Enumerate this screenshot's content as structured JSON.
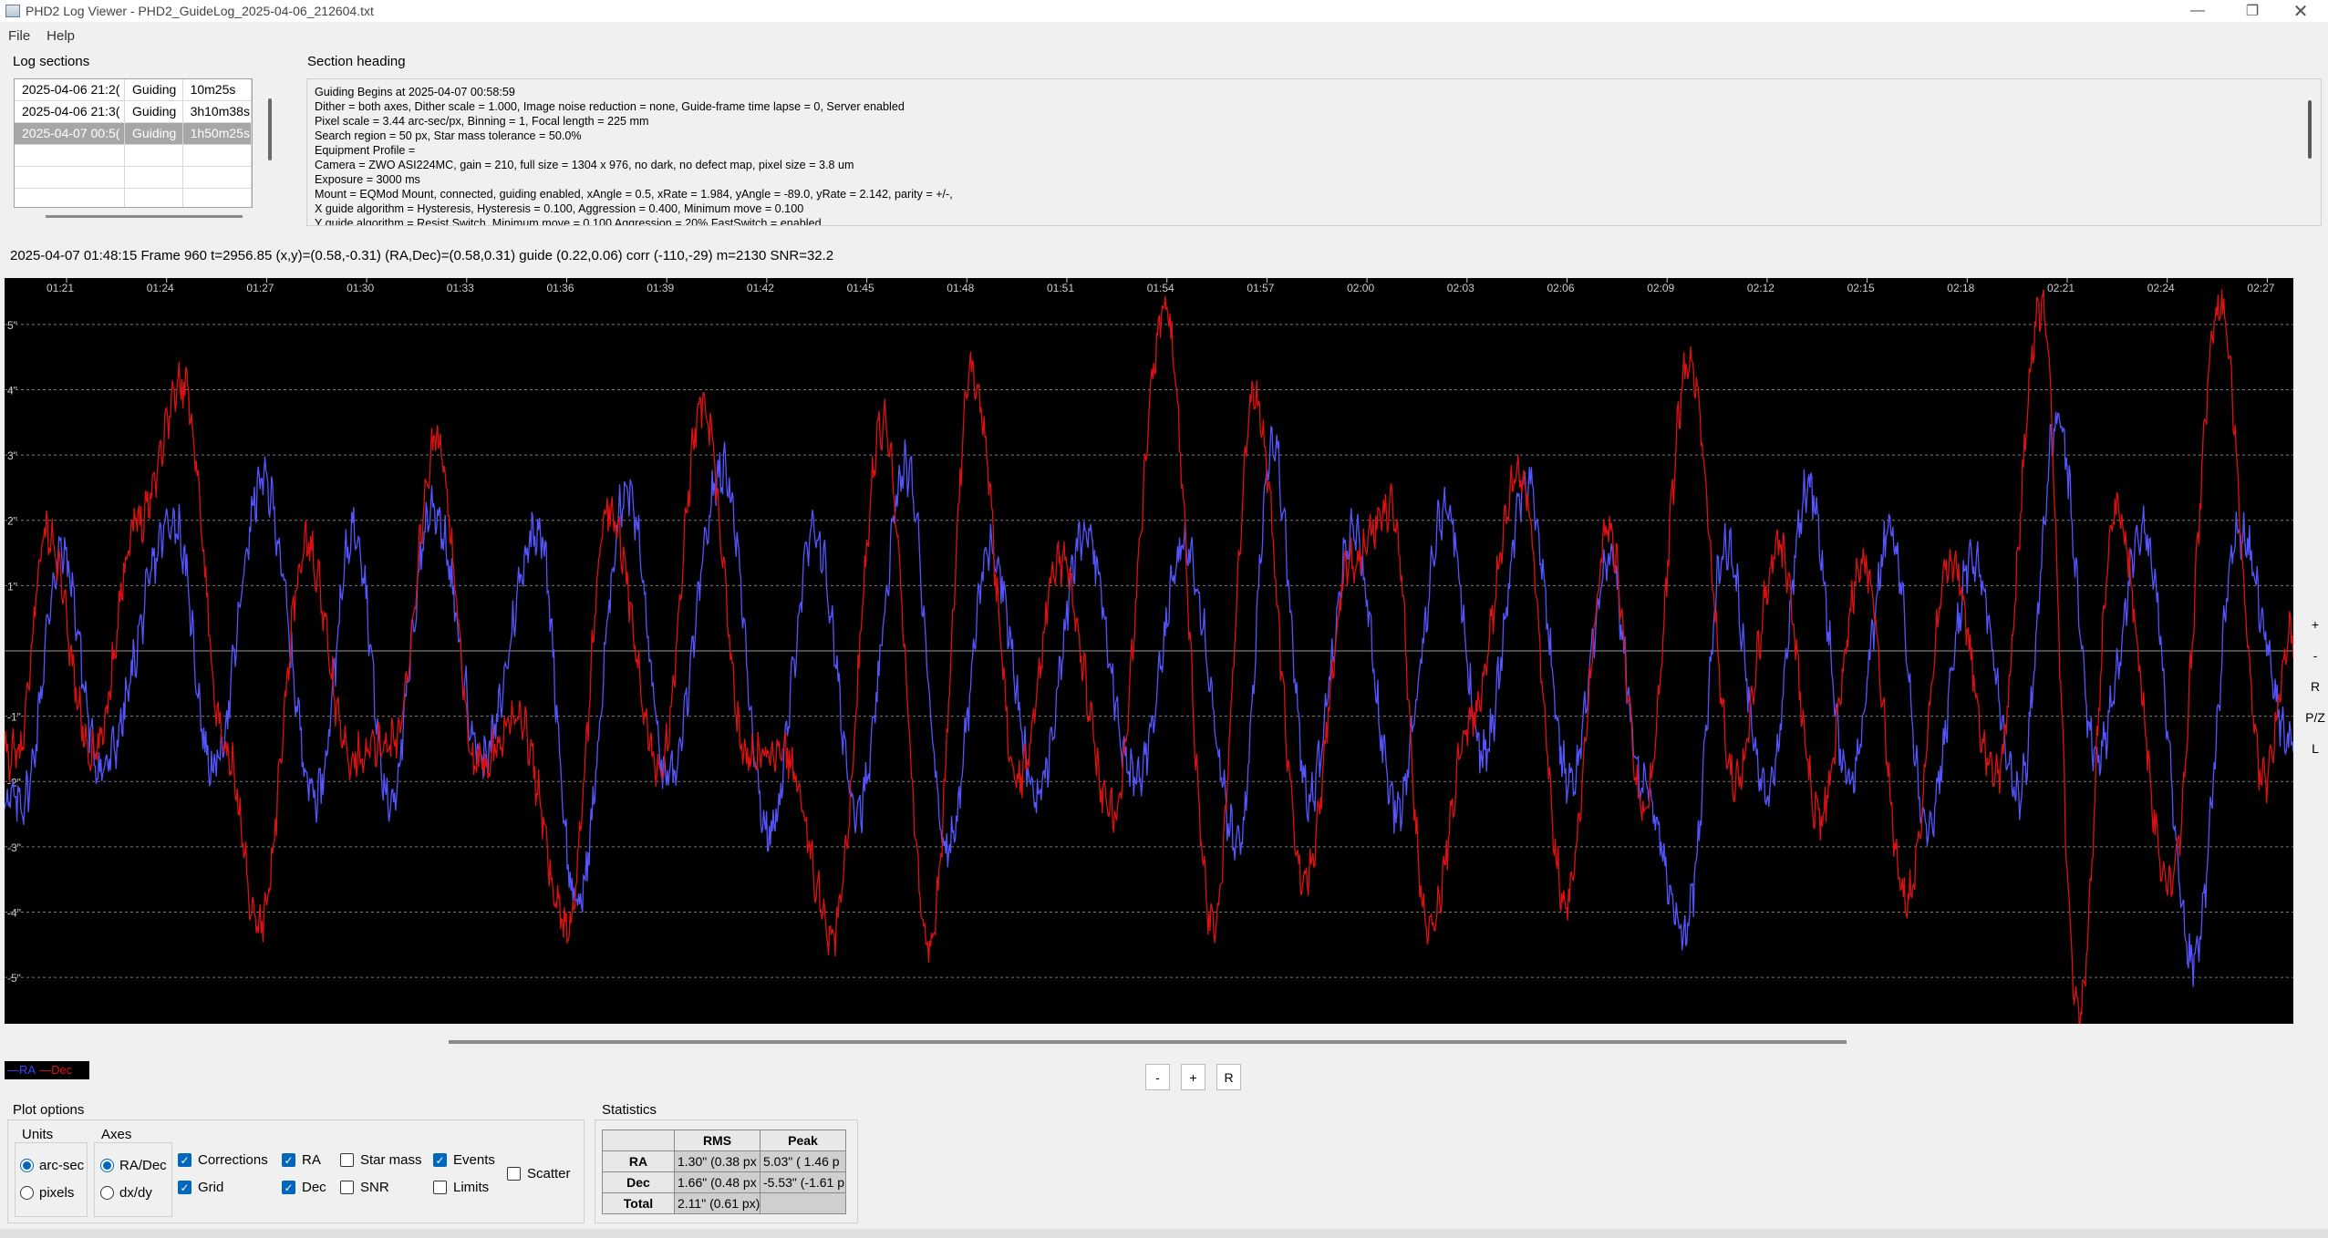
{
  "window": {
    "title": "PHD2 Log Viewer - PHD2_GuideLog_2025-04-06_212604.txt"
  },
  "menu": [
    "File",
    "Help"
  ],
  "log_sections": {
    "title": "Log sections",
    "rows": [
      {
        "time": "2025-04-06 21:2(",
        "type": "Guiding",
        "duration": "10m25s",
        "selected": false
      },
      {
        "time": "2025-04-06 21:3(",
        "type": "Guiding",
        "duration": "3h10m38s",
        "selected": false
      },
      {
        "time": "2025-04-07 00:5(",
        "type": "Guiding",
        "duration": "1h50m25s",
        "selected": true
      },
      {
        "time": "",
        "type": "",
        "duration": "",
        "selected": false
      },
      {
        "time": "",
        "type": "",
        "duration": "",
        "selected": false
      },
      {
        "time": "",
        "type": "",
        "duration": "",
        "selected": false
      }
    ]
  },
  "section_heading": {
    "title": "Section heading",
    "lines": [
      "Guiding Begins at 2025-04-07 00:58:59",
      "Dither = both axes, Dither scale = 1.000, Image noise reduction = none, Guide-frame time lapse = 0, Server enabled",
      "Pixel scale = 3.44 arc-sec/px, Binning = 1, Focal length = 225 mm",
      "Search region = 50 px, Star mass tolerance = 50.0%",
      "Equipment Profile =",
      "Camera = ZWO ASI224MC, gain = 210, full size = 1304 x 976, no dark, no defect map, pixel size = 3.8 um",
      "Exposure = 3000 ms",
      "Mount = EQMod Mount,  connected, guiding enabled, xAngle = 0.5, xRate = 1.984, yAngle = -89.0, yRate = 2.142, parity = +/-,",
      "X guide algorithm = Hysteresis, Hysteresis = 0.100, Aggression = 0.400, Minimum move = 0.100",
      "Y guide algorithm = Resist Switch, Minimum move = 0.100 Aggression = 20% FastSwitch = enabled"
    ]
  },
  "status_line": "2025-04-07 01:48:15 Frame 960 t=2956.85 (x,y)=(0.58,-0.31) (RA,Dec)=(0.58,0.31) guide (0.22,0.06) corr (-110,-29) m=2130 SNR=32.2",
  "chart_data": {
    "type": "line",
    "x_ticks": [
      "01:21",
      "01:24",
      "01:27",
      "01:30",
      "01:33",
      "01:36",
      "01:39",
      "01:42",
      "01:45",
      "01:48",
      "01:51",
      "01:54",
      "01:57",
      "02:00",
      "02:03",
      "02:06",
      "02:09",
      "02:12",
      "02:15",
      "02:18",
      "02:21",
      "02:24",
      "02:27"
    ],
    "y_ticks": [
      "5\"",
      "4\"",
      "3\"",
      "2\"",
      "1\"",
      "",
      "-1\"",
      "-2\"",
      "-3\"",
      "-4\"",
      "-5\""
    ],
    "ylim": [
      -5.5,
      5.5
    ],
    "grid": true,
    "series": [
      {
        "name": "RA",
        "color": "#5555ff",
        "peaks": [
          [
            0.8,
            -2.3
          ],
          [
            2.5,
            1.5
          ],
          [
            4.2,
            -1.8
          ],
          [
            7.4,
            2.0
          ],
          [
            9.1,
            -1.8
          ],
          [
            11.3,
            2.6
          ],
          [
            13.6,
            -2.2
          ],
          [
            15.3,
            1.9
          ],
          [
            16.8,
            -2.3
          ],
          [
            18.7,
            2.2
          ],
          [
            20.9,
            -1.6
          ],
          [
            23.3,
            1.9
          ],
          [
            25.0,
            -3.9
          ],
          [
            27.2,
            2.5
          ],
          [
            29.0,
            -2.0
          ],
          [
            31.4,
            2.8
          ],
          [
            33.4,
            -2.8
          ],
          [
            35.4,
            1.8
          ],
          [
            37.3,
            -2.4
          ],
          [
            39.4,
            2.8
          ],
          [
            41.2,
            -3.0
          ],
          [
            43.1,
            1.6
          ],
          [
            45.1,
            -2.2
          ],
          [
            47.2,
            1.8
          ],
          [
            49.4,
            -2.0
          ],
          [
            51.6,
            1.6
          ],
          [
            53.9,
            -3.0
          ],
          [
            55.4,
            3.2
          ],
          [
            57.0,
            -2.2
          ],
          [
            58.9,
            1.8
          ],
          [
            60.8,
            -2.4
          ],
          [
            63.0,
            2.2
          ],
          [
            64.6,
            -1.6
          ],
          [
            66.5,
            2.6
          ],
          [
            68.4,
            -2.0
          ],
          [
            70.1,
            1.4
          ],
          [
            71.6,
            -2.1
          ],
          [
            73.4,
            -4.3
          ],
          [
            75.2,
            1.6
          ],
          [
            77.0,
            -2.2
          ],
          [
            78.8,
            2.5
          ],
          [
            80.6,
            -2.0
          ],
          [
            82.4,
            1.8
          ],
          [
            84.0,
            -2.6
          ],
          [
            86.0,
            1.4
          ],
          [
            88.0,
            -2.2
          ],
          [
            89.7,
            3.5
          ],
          [
            91.4,
            -1.6
          ],
          [
            93.5,
            1.8
          ],
          [
            95.6,
            -4.8
          ],
          [
            97.6,
            1.8
          ],
          [
            100,
            -1.5
          ]
        ]
      },
      {
        "name": "Dec",
        "color": "#dd1111",
        "peaks": [
          [
            0.6,
            -1.6
          ],
          [
            1.8,
            1.8
          ],
          [
            3.9,
            -1.6
          ],
          [
            5.8,
            2.0
          ],
          [
            7.8,
            4.1
          ],
          [
            9.7,
            -1.6
          ],
          [
            11.1,
            -4.2
          ],
          [
            13.2,
            1.6
          ],
          [
            15.1,
            -1.6
          ],
          [
            17.0,
            -1.4
          ],
          [
            18.9,
            3.2
          ],
          [
            20.6,
            -1.8
          ],
          [
            22.4,
            -1.0
          ],
          [
            24.6,
            -4.2
          ],
          [
            26.4,
            2.2
          ],
          [
            28.6,
            -1.8
          ],
          [
            30.5,
            3.8
          ],
          [
            32.4,
            -1.6
          ],
          [
            34.1,
            -1.6
          ],
          [
            36.2,
            -4.3
          ],
          [
            38.4,
            3.5
          ],
          [
            40.4,
            -4.5
          ],
          [
            42.3,
            4.3
          ],
          [
            44.3,
            -2.0
          ],
          [
            46.1,
            1.4
          ],
          [
            48.4,
            -2.5
          ],
          [
            50.7,
            5.2
          ],
          [
            52.8,
            -4.2
          ],
          [
            54.6,
            3.9
          ],
          [
            56.8,
            -3.5
          ],
          [
            58.8,
            1.4
          ],
          [
            60.6,
            2.2
          ],
          [
            62.2,
            -4.3
          ],
          [
            64.1,
            -1.0
          ],
          [
            66.2,
            2.8
          ],
          [
            68.2,
            -3.8
          ],
          [
            70.1,
            1.8
          ],
          [
            71.6,
            -2.4
          ],
          [
            73.6,
            4.4
          ],
          [
            75.6,
            -2.0
          ],
          [
            77.5,
            1.6
          ],
          [
            79.3,
            -2.5
          ],
          [
            81.2,
            1.4
          ],
          [
            83.1,
            -3.8
          ],
          [
            85.0,
            1.4
          ],
          [
            87.0,
            -2.0
          ],
          [
            89.0,
            5.3
          ],
          [
            90.6,
            -5.6
          ],
          [
            92.2,
            2.2
          ],
          [
            94.6,
            -3.6
          ],
          [
            96.8,
            5.3
          ],
          [
            98.7,
            -2.0
          ],
          [
            100,
            0.3
          ]
        ]
      }
    ]
  },
  "plot_side_buttons": [
    "+",
    "-",
    "R",
    "P/Z",
    "L"
  ],
  "zoom_buttons": [
    "-",
    "+",
    "R"
  ],
  "legend": {
    "ra": "—RA",
    "dec": "—Dec"
  },
  "plot_options": {
    "title": "Plot options",
    "units": {
      "title": "Units",
      "arcsec": "arc-sec",
      "pixels": "pixels",
      "selected": "arcsec"
    },
    "axes": {
      "title": "Axes",
      "radec": "RA/Dec",
      "dxdy": "dx/dy",
      "selected": "radec"
    },
    "checks": {
      "corrections": {
        "label": "Corrections",
        "checked": true
      },
      "grid": {
        "label": "Grid",
        "checked": true
      },
      "ra": {
        "label": "RA",
        "checked": true
      },
      "dec": {
        "label": "Dec",
        "checked": true
      },
      "star_mass": {
        "label": "Star mass",
        "checked": false
      },
      "snr": {
        "label": "SNR",
        "checked": false
      },
      "events": {
        "label": "Events",
        "checked": true
      },
      "limits": {
        "label": "Limits",
        "checked": false
      },
      "scatter": {
        "label": "Scatter",
        "checked": false
      }
    }
  },
  "statistics": {
    "title": "Statistics",
    "headers": [
      "",
      "RMS",
      "Peak"
    ],
    "rows": [
      {
        "label": "RA",
        "rms": "1.30\" (0.38 px",
        "peak": "5.03\" ( 1.46 p"
      },
      {
        "label": "Dec",
        "rms": "1.66\" (0.48 px",
        "peak": "-5.53\" (-1.61 p"
      },
      {
        "label": "Total",
        "rms": "2.11\" (0.61 px)",
        "peak": ""
      }
    ]
  }
}
